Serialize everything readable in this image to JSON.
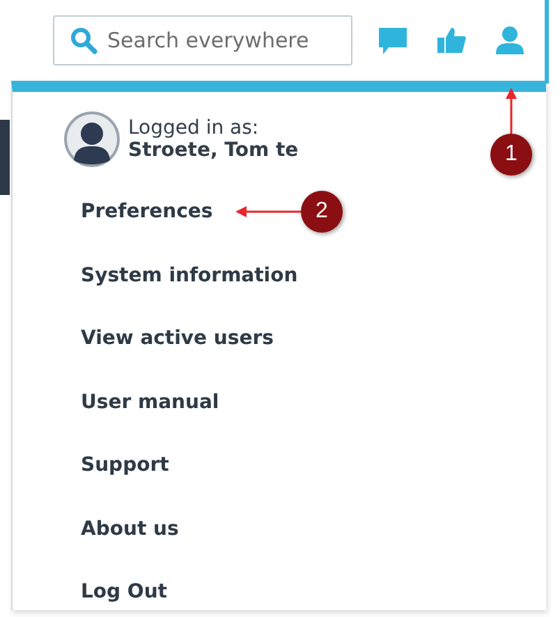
{
  "search": {
    "placeholder": "Search everywhere"
  },
  "user": {
    "caption": "Logged in as:",
    "name": "Stroete, Tom te"
  },
  "menu": [
    {
      "label": "Preferences"
    },
    {
      "label": "System information"
    },
    {
      "label": "View active users"
    },
    {
      "label": "User manual"
    },
    {
      "label": "Support"
    },
    {
      "label": "About us"
    },
    {
      "label": "Log Out"
    }
  ],
  "callouts": [
    {
      "number": "1"
    },
    {
      "number": "2"
    }
  ]
}
